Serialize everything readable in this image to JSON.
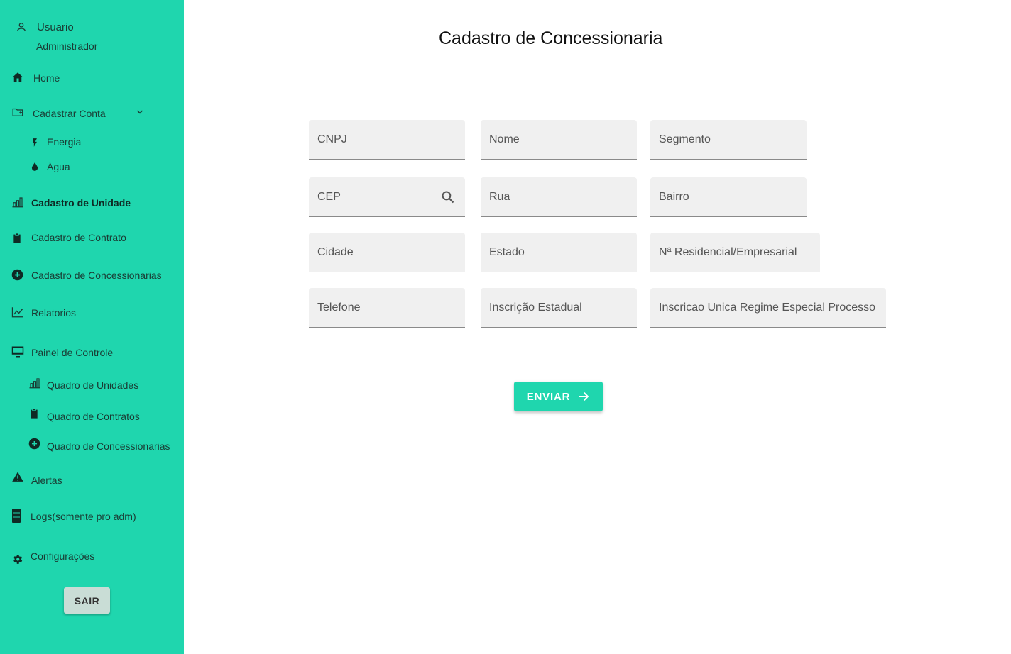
{
  "user": {
    "title": "Usuario",
    "role": "Administrador",
    "icon": "person-icon"
  },
  "sidebar": {
    "home": "Home",
    "cadastrar_conta": "Cadastrar Conta",
    "energia": "Energia",
    "agua": "Água",
    "cadastro_unidade": "Cadastro de Unidade",
    "cadastro_contrato": "Cadastro de Contrato",
    "cadastro_concessionarias": "Cadastro de Concessionarias",
    "relatorios": "Relatorios",
    "painel_controle": "Painel de Controle",
    "quadro_unidades": "Quadro de Unidades",
    "quadro_contratos": "Quadro de Contratos",
    "quadro_concessionarias": "Quadro de Concessionarias",
    "alertas": "Alertas",
    "logs": "Logs(somente pro adm)",
    "configuracoes": "Configurações",
    "sair": "SAIR"
  },
  "main": {
    "title": "Cadastro de Concessionaria",
    "fields": {
      "cnpj": "CNPJ",
      "nome": "Nome",
      "segmento": "Segmento",
      "cep": "CEP",
      "rua": "Rua",
      "bairro": "Bairro",
      "cidade": "Cidade",
      "estado": "Estado",
      "numero": "Nª Residencial/Empresarial",
      "telefone": "Telefone",
      "inscricao_estadual": "Inscrição Estadual",
      "inscricao_unica": "Inscricao Unica Regime Especial Processo"
    },
    "submit_label": "ENVIAR"
  },
  "colors": {
    "accent": "#1fd6ae",
    "field_bg": "#f0f0f0",
    "sair_bg": "#c9ddd6"
  }
}
